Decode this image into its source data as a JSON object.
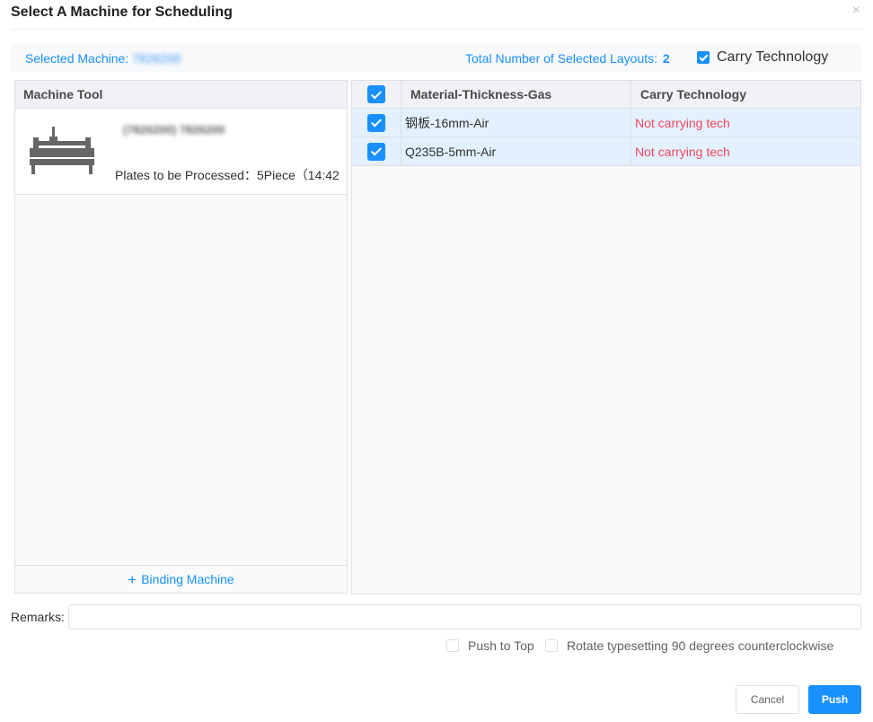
{
  "dialog": {
    "title": "Select A Machine for Scheduling",
    "close_icon": "×"
  },
  "info_bar": {
    "selected_machine_label": "Selected Machine:",
    "selected_machine_value": "7826200",
    "total_layouts_label": "Total Number of Selected Layouts:",
    "total_layouts_value": "2",
    "carry_technology_label": "Carry Technology",
    "carry_technology_checked": true
  },
  "machine_panel": {
    "header": "Machine Tool",
    "machines": [
      {
        "name": "(7826200) 7826200",
        "icon": "cnc-machine-icon",
        "plates_text": "Plates to be Processed：5Piece（14:42"
      }
    ],
    "binding_label": "Binding Machine",
    "binding_icon": "+"
  },
  "layouts_table": {
    "columns": [
      "Material-Thickness-Gas",
      "Carry Technology"
    ],
    "header_checked": true,
    "rows": [
      {
        "checked": true,
        "material": "钢板-16mm-Air",
        "technology": "Not carrying tech"
      },
      {
        "checked": true,
        "material": "Q235B-5mm-Air",
        "technology": "Not carrying tech"
      }
    ]
  },
  "remarks": {
    "label": "Remarks:",
    "value": "",
    "placeholder": ""
  },
  "options": {
    "push_to_top": {
      "label": "Push to Top",
      "checked": false
    },
    "rotate": {
      "label": "Rotate typesetting 90 degrees counterclockwise",
      "checked": false
    }
  },
  "buttons": {
    "cancel": "Cancel",
    "push": "Push"
  },
  "colors": {
    "accent": "#1890ff",
    "warning_text": "#f5455c",
    "row_selected": "#e3f1fe"
  }
}
